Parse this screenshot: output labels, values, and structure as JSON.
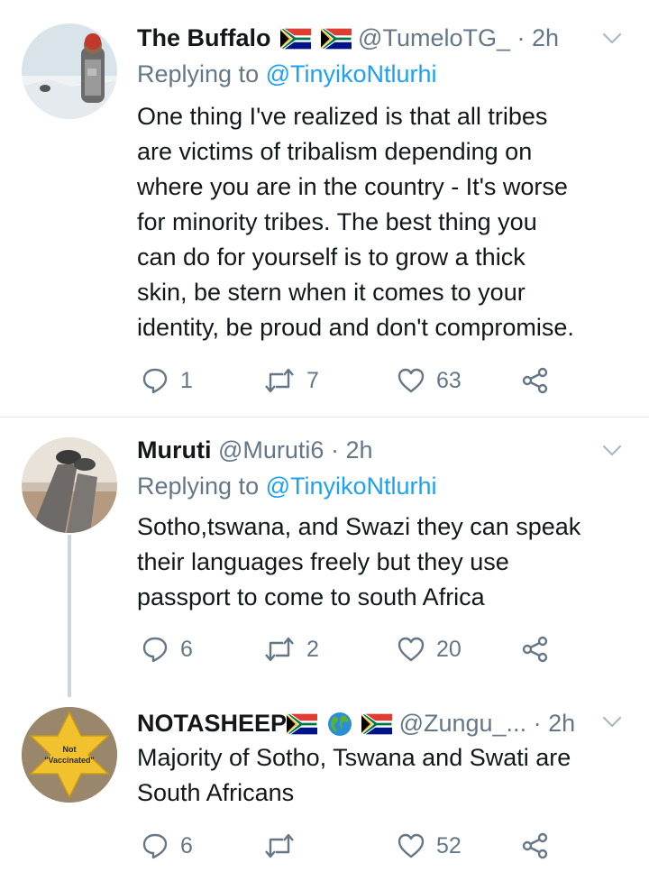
{
  "tweets": [
    {
      "name": "The Buffalo",
      "handle": "@TumeloTG_",
      "time": "2h",
      "replying_label": "Replying to",
      "replying_to": "@TinyikoNtlurhi",
      "lines": [
        "One thing I've realized is that all tribes",
        "are victims of tribalism depending on",
        "where you are in the country - It's worse",
        "for minority tribes. The best thing you",
        "can do for yourself is to grow a thick",
        "skin, be stern when it comes to your",
        "identity, be proud and don't compromise."
      ],
      "replies": "1",
      "retweets": "7",
      "likes": "63"
    },
    {
      "name": "Muruti",
      "handle": "@Muruti6",
      "time": "2h",
      "replying_label": "Replying to",
      "replying_to": "@TinyikoNtlurhi",
      "lines": [
        "Sotho,tswana, and Swazi they can speak",
        "their  languages freely but they use",
        "passport to come to south Africa"
      ],
      "replies": "6",
      "retweets": "2",
      "likes": "20"
    },
    {
      "name": "NOTASHEEP",
      "handle": "@Zungu_...",
      "time": "2h",
      "avatar_text_1": "Not",
      "avatar_text_2": "\"Vaccinated\"",
      "lines": [
        "Majority of Sotho, Tswana and Swati are",
        "South Africans"
      ],
      "replies": "6",
      "retweets": "",
      "likes": "52"
    }
  ],
  "separator": "·",
  "colors": {
    "text": "#14171a",
    "muted": "#657786",
    "link": "#1da1f2",
    "divider": "#e1e8ed",
    "thread_line": "#ccd6dd"
  },
  "icons": [
    "reply-icon",
    "retweet-icon",
    "like-icon",
    "share-icon",
    "chevron-down-icon",
    "sa-flag-icon",
    "globe-icon"
  ]
}
